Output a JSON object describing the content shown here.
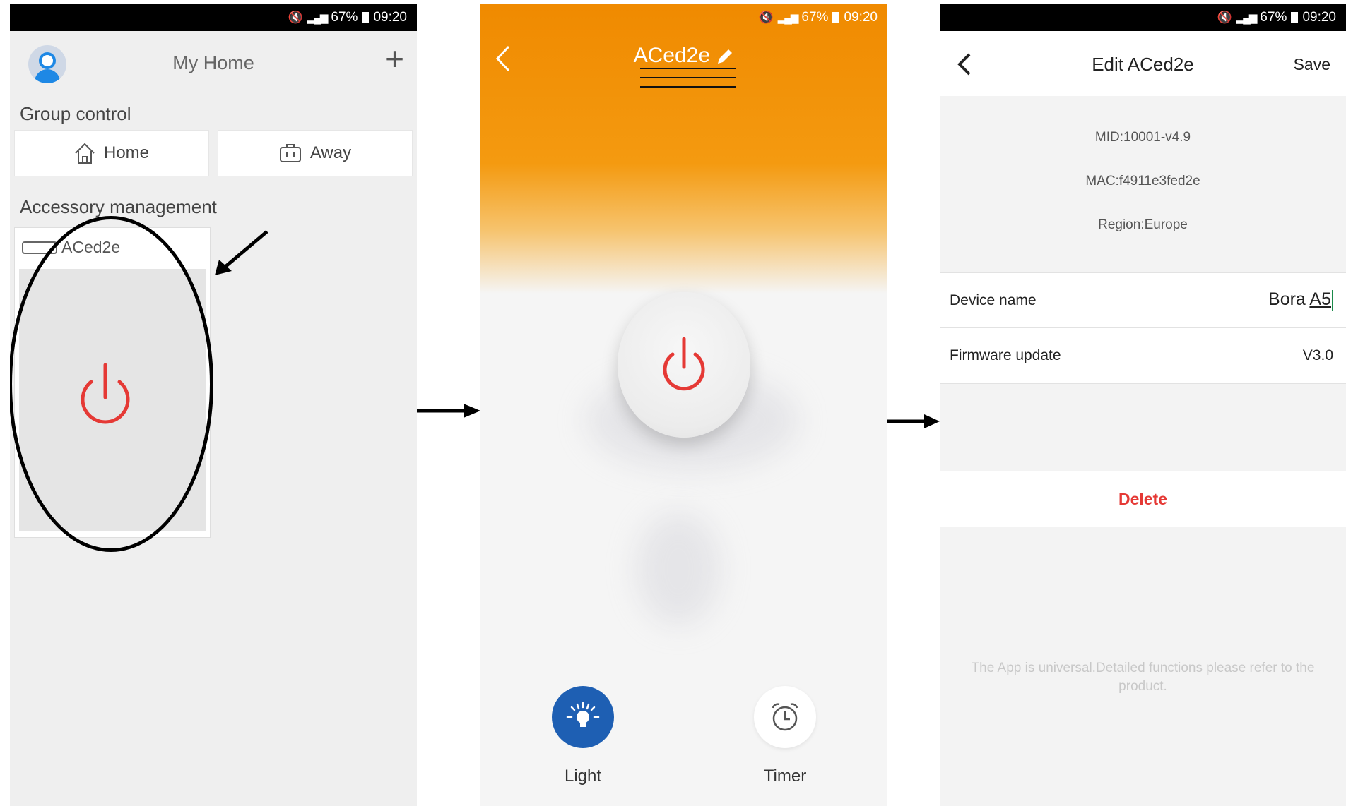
{
  "status_bar": {
    "battery": "67%",
    "time": "09:20"
  },
  "screen_home": {
    "title": "My Home",
    "group_control_label": "Group control",
    "home_button": "Home",
    "away_button": "Away",
    "accessory_label": "Accessory management",
    "device_name": "ACed2e"
  },
  "screen_device": {
    "title": "ACed2e",
    "light_label": "Light",
    "timer_label": "Timer"
  },
  "screen_edit": {
    "title": "Edit  ACed2e",
    "save_label": "Save",
    "mid": "MID:10001-v4.9",
    "mac": "MAC:f4911e3fed2e",
    "region": "Region:Europe",
    "device_name_label": "Device name",
    "device_name_value_a": "Bora ",
    "device_name_value_b": "A5",
    "firmware_label": "Firmware update",
    "firmware_value": "V3.0",
    "delete_label": "Delete",
    "footnote": "The App is universal.Detailed functions please refer to the product."
  },
  "colors": {
    "accent_orange": "#f08a00",
    "power_red": "#e53935",
    "light_blue": "#1e5fb3"
  }
}
